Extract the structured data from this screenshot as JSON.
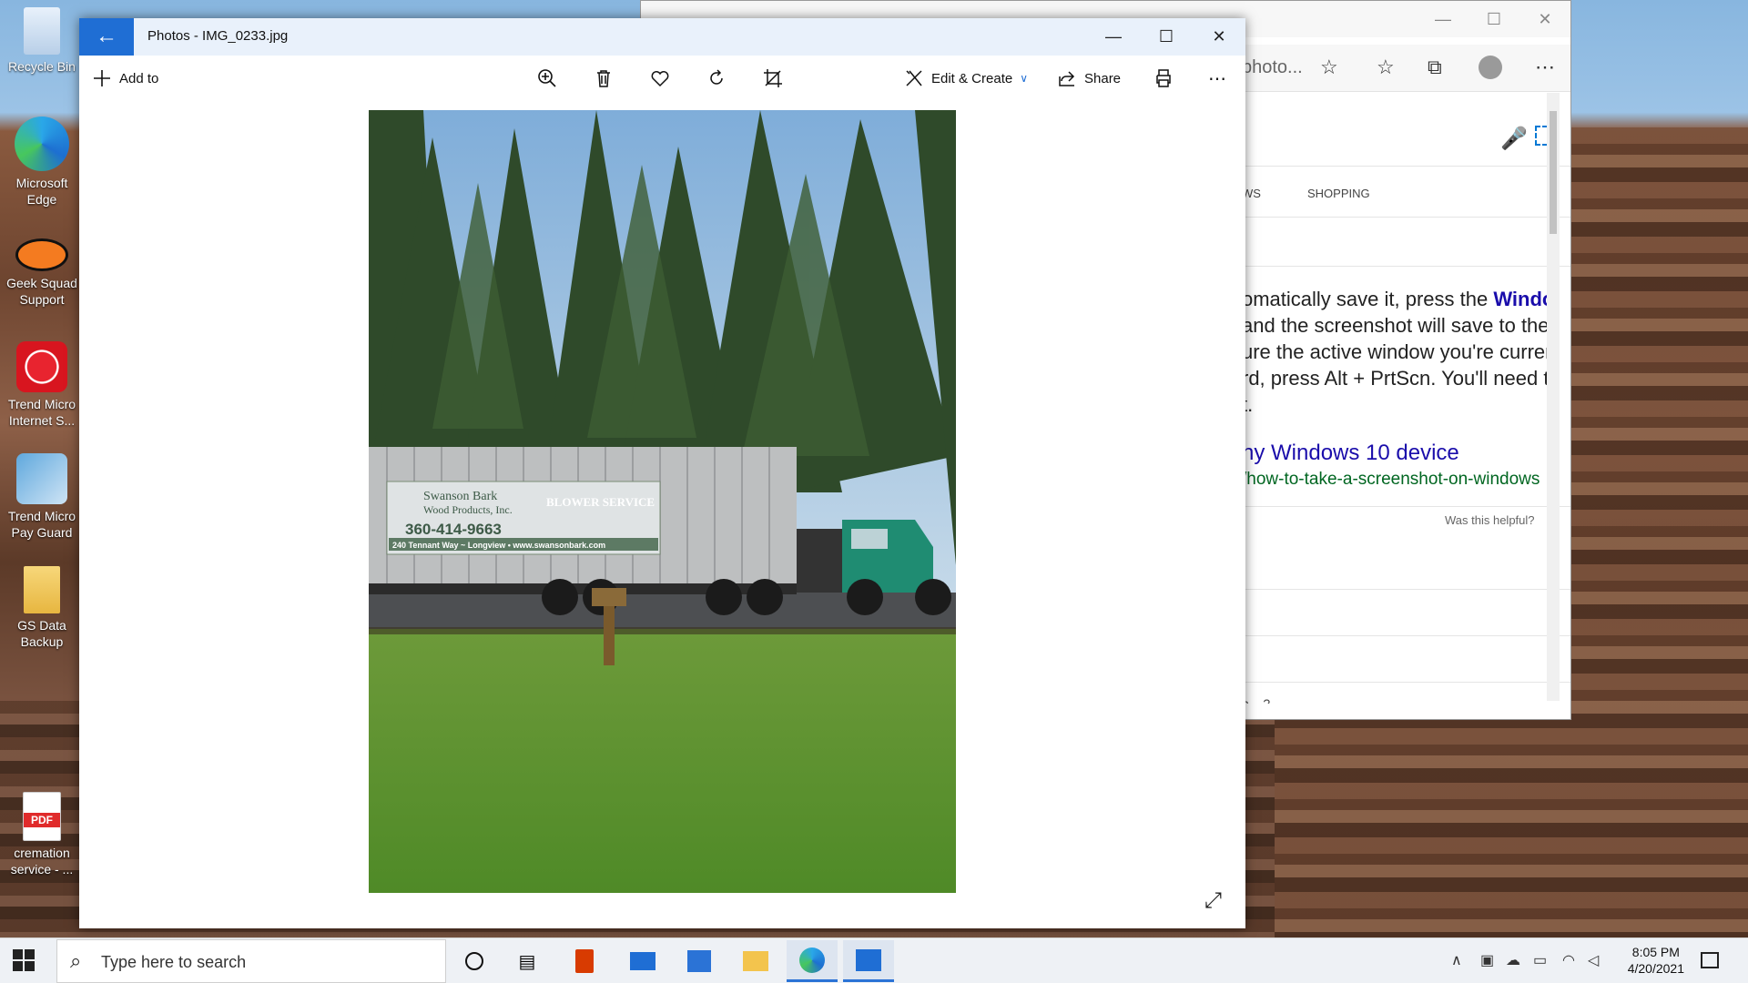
{
  "desktop": {
    "icons": [
      {
        "label": "Recycle Bin",
        "icon": "recycle-bin-icon"
      },
      {
        "label": "Microsoft Edge",
        "icon": "edge-icon"
      },
      {
        "label": "Geek Squad Support",
        "icon": "geek-squad-icon"
      },
      {
        "label": "Trend Micro Internet S...",
        "icon": "trend-micro-icon"
      },
      {
        "label": "Trend Micro Pay Guard",
        "icon": "trend-micro-payguard-icon"
      },
      {
        "label": "GS Data Backup",
        "icon": "folder-icon"
      },
      {
        "label": "cremation service - ...",
        "icon": "pdf-icon",
        "badge": "PDF"
      }
    ]
  },
  "browser": {
    "address_text": "photo...",
    "tabs_text": "WS",
    "shopping_label": "SHOPPING",
    "snippet_lines": [
      "omatically save it, press the ",
      "and the screenshot will save to the",
      "ure the active window you're curren",
      "rd, press Alt + PrtScn. You'll need to",
      "t."
    ],
    "snippet_bold": "Windo",
    "result_title": "ny Windows 10 device",
    "result_url": "/how-to-take-a-screenshot-on-windows",
    "helpful": "Was this helpful?",
    "footer_fragment": "h ..  ?",
    "colors": {
      "link": "#1a0dab",
      "url": "#006621"
    }
  },
  "photos": {
    "title": "Photos - IMG_0233.jpg",
    "add_to": "Add to",
    "edit_create": "Edit & Create",
    "share": "Share",
    "sign": {
      "company": "Swanson Bark",
      "company2": "Wood Products, Inc.",
      "service": "BLOWER SERVICE",
      "phone": "360-414-9663",
      "address": "240 Tennant Way ~ Longview • www.swansonbark.com"
    }
  },
  "taskbar": {
    "search_placeholder": "Type here to search",
    "time": "8:05 PM",
    "date": "4/20/2021",
    "accent": "#2b73d6"
  }
}
